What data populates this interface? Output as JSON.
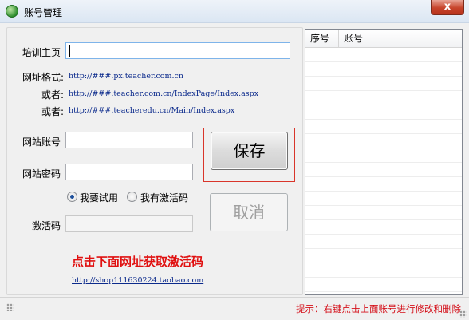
{
  "window": {
    "title": "账号管理",
    "close_label": "x"
  },
  "form": {
    "homepage_label": "培训主页",
    "homepage_value": "",
    "format_label": "网址格式:",
    "format_example_1": "http://###.px.teacher.com.cn",
    "or_label_1": "或者:",
    "format_example_2": "http://###.teacher.com.cn/IndexPage/Index.aspx",
    "or_label_2": "或者:",
    "format_example_3": "http://###.teacheredu.cn/Main/Index.aspx",
    "account_label": "网站账号",
    "account_value": "",
    "password_label": "网站密码",
    "password_value": "",
    "radio_trial_label": "我要试用",
    "radio_code_label": "我有激活码",
    "selected_radio": "trial",
    "activation_label": "激活码",
    "activation_value": ""
  },
  "buttons": {
    "save_label": "保存",
    "cancel_label": "取消"
  },
  "notice": {
    "text": "点击下面网址获取激活码",
    "link": "http://shop111630224.taobao.com"
  },
  "list": {
    "columns": [
      "序号",
      "账号"
    ],
    "rows": []
  },
  "status": {
    "text": "提示：右键点击上面账号进行修改和删除"
  }
}
